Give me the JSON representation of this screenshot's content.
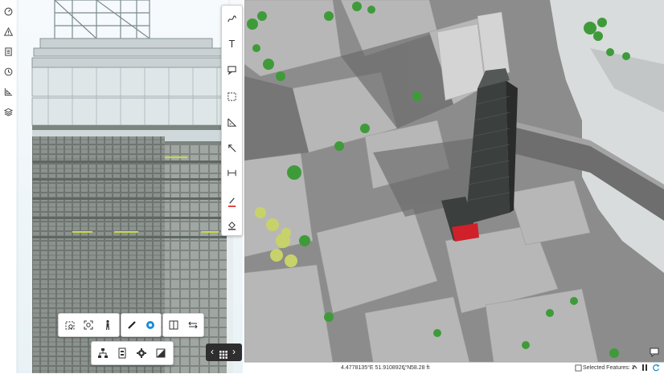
{
  "left_toolbar": {
    "items": [
      {
        "icon": "gauge-icon"
      },
      {
        "icon": "warning-icon"
      },
      {
        "icon": "document-icon"
      },
      {
        "icon": "clock-icon"
      },
      {
        "icon": "measure-area-icon"
      },
      {
        "icon": "layers-icon"
      }
    ]
  },
  "draw_toolbar": {
    "items": [
      {
        "icon": "freehand-icon"
      },
      {
        "icon": "text-icon"
      },
      {
        "icon": "callout-icon"
      },
      {
        "icon": "select-rectangle-icon"
      },
      {
        "icon": "triangle-icon"
      },
      {
        "icon": "arrow-icon"
      },
      {
        "icon": "dimension-icon"
      },
      {
        "icon": "pencil-icon"
      },
      {
        "icon": "fill-icon"
      }
    ],
    "text_tool_label": "T",
    "pen_color": "#e23b3b"
  },
  "bottom_tools": {
    "group1": [
      "section-box-icon",
      "fit-view-icon",
      "walk-person-icon"
    ],
    "group2": [
      "markup-pen-icon",
      "measure-tape-icon"
    ],
    "group3": [
      "split-view-icon",
      "swap-icon"
    ],
    "group4": [
      "tree-hierarchy-icon",
      "properties-icon",
      "settings-icon",
      "render-mode-icon"
    ]
  },
  "nav_pill": {
    "prev": "‹",
    "grid_icon": "grid-icon",
    "next": "›"
  },
  "status_bar": {
    "coordinates": "4.4778135°E 51.9108926°N",
    "elevation": "58.28 ft",
    "selected_features": "Selected Features: 1"
  },
  "colors": {
    "accent": "#1b8ed6",
    "highlight_red": "#d0202a",
    "tree_green": "#3f9b3a",
    "tree_yellow": "#c8d26a"
  }
}
